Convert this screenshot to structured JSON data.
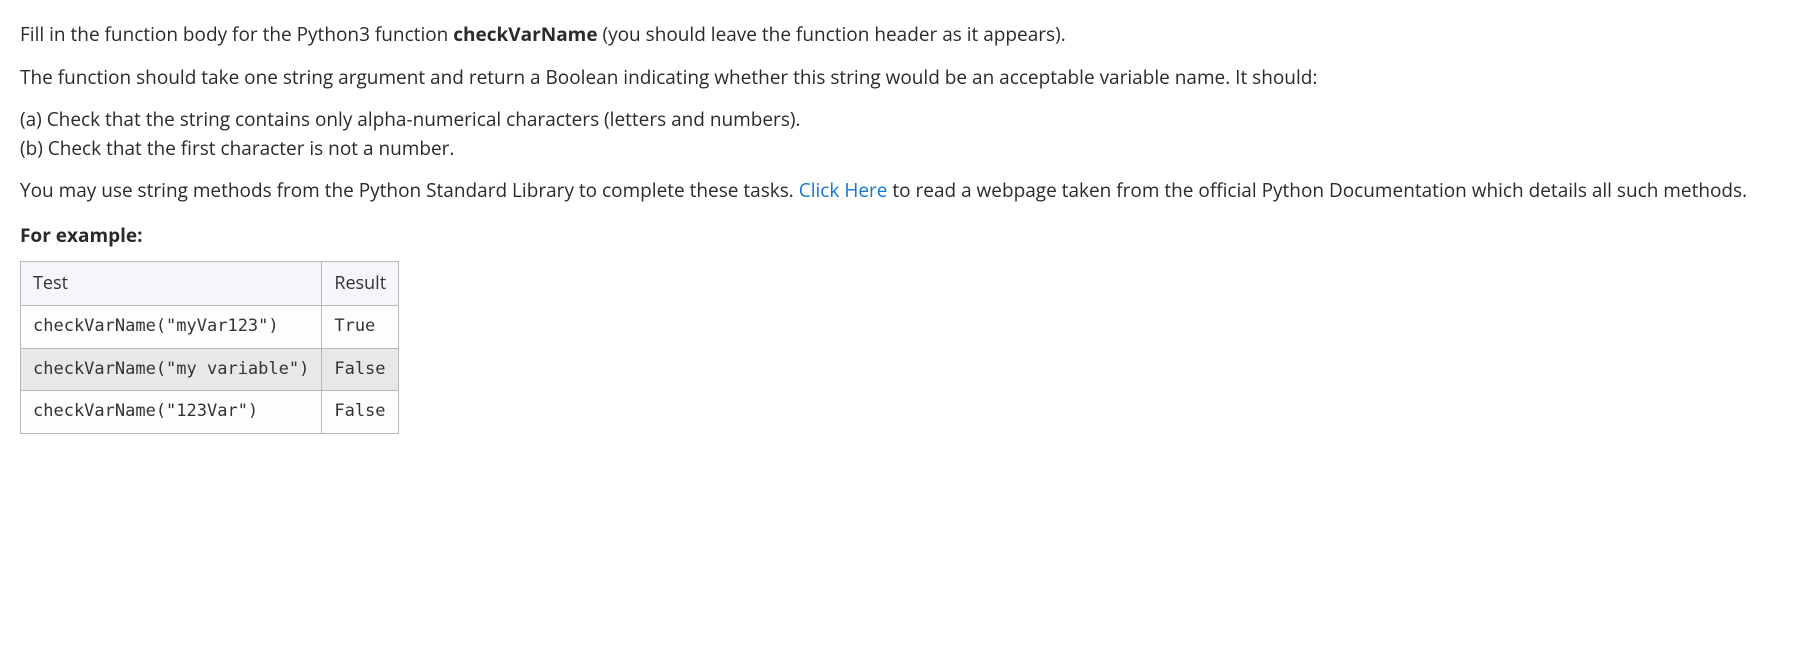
{
  "intro": {
    "pre_text": "Fill in the function body for the Python3 function ",
    "func_name": "checkVarName",
    "post_text": " (you should leave the function header as it appears)."
  },
  "description": "The function should take one string argument and return a Boolean indicating whether this string would be an acceptable variable name.  It should:",
  "letters": {
    "a": "(a) Check that the string contains only alpha-numerical characters (letters and numbers).",
    "b": "(b) Check that the first character is not a number."
  },
  "methods_line": {
    "pre_text": "You may use string methods from the Python Standard Library to complete these tasks.  ",
    "link_text": "Click Here",
    "post_text": " to read a webpage taken from the official Python Documentation which details all such methods."
  },
  "example_label": "For example:",
  "table": {
    "headers": [
      "Test",
      "Result"
    ],
    "rows": [
      {
        "test": "checkVarName(\"myVar123\")",
        "result": "True"
      },
      {
        "test": "checkVarName(\"my variable\")",
        "result": "False"
      },
      {
        "test": "checkVarName(\"123Var\")",
        "result": "False"
      }
    ]
  }
}
